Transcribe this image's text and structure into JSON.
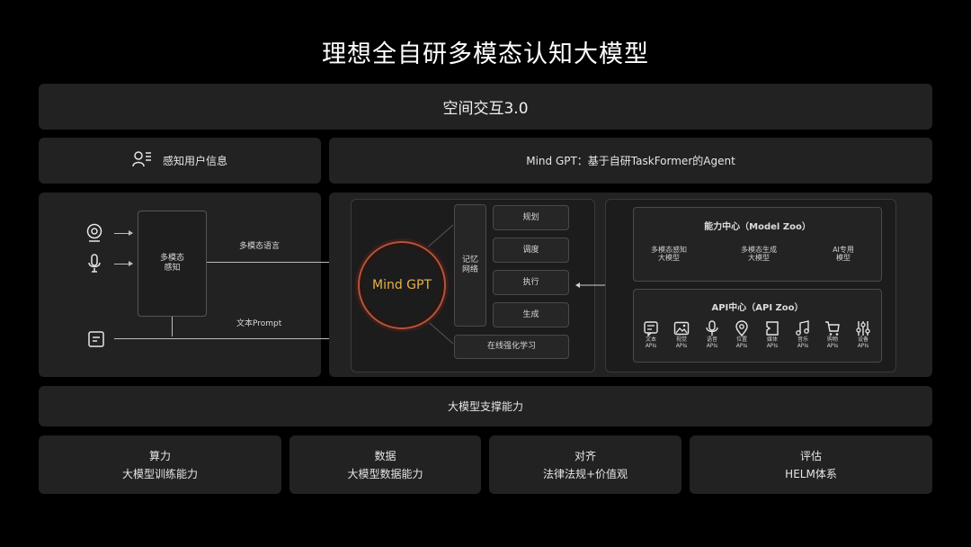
{
  "title": "理想全自研多模态认知大模型",
  "top_bar": "空间交互3.0",
  "perception_header": "感知用户信息",
  "agent_header": "Mind GPT：基于自研TaskFormer的Agent",
  "perception": {
    "box_label": "多模态\n感知",
    "arrow1_label": "多模态语言",
    "arrow2_label": "文本Prompt"
  },
  "mindgpt": {
    "core_label": "Mind GPT",
    "memory_label": "记忆\n网络",
    "steps": [
      "规划",
      "调度",
      "执行",
      "生成"
    ],
    "online_learning": "在线强化学习"
  },
  "model_zoo": {
    "title": "能力中心（Model Zoo）",
    "items": [
      "多模态感知\n大模型",
      "多模态生成\n大模型",
      "AI专用\n模型"
    ]
  },
  "api_zoo": {
    "title": "API中心（API Zoo）",
    "items": [
      {
        "icon": "text-icon",
        "label": "文本\nAPIs"
      },
      {
        "icon": "image-icon",
        "label": "视觉\nAPIs"
      },
      {
        "icon": "microphone-icon",
        "label": "语音\nAPIs"
      },
      {
        "icon": "location-icon",
        "label": "位置\nAPIs"
      },
      {
        "icon": "media-icon",
        "label": "媒体\nAPIs"
      },
      {
        "icon": "music-icon",
        "label": "音乐\nAPIs"
      },
      {
        "icon": "cart-icon",
        "label": "购物\nAPIs"
      },
      {
        "icon": "settings-sliders-icon",
        "label": "设备\nAPIs"
      }
    ]
  },
  "support_bar": "大模型支撑能力",
  "bottom": [
    {
      "title": "算力",
      "subtitle": "大模型训练能力"
    },
    {
      "title": "数据",
      "subtitle": "大模型数据能力"
    },
    {
      "title": "对齐",
      "subtitle": "法律法规+价值观"
    },
    {
      "title": "评估",
      "subtitle": "HELM体系"
    }
  ]
}
